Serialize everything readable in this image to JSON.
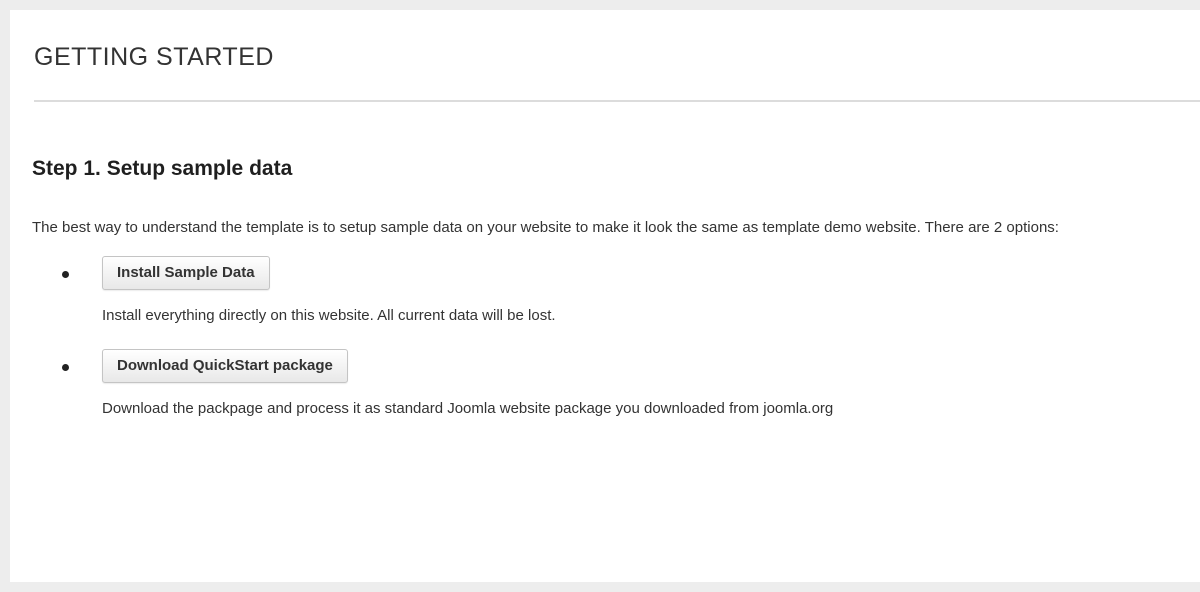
{
  "panel": {
    "title": "GETTING STARTED"
  },
  "step": {
    "title": "Step 1. Setup sample data",
    "intro": "The best way to understand the template is to setup sample data on your website to make it look the same as template demo website. There are 2 options:"
  },
  "options": [
    {
      "button_label": "Install Sample Data",
      "description": "Install everything directly on this website. All current data will be lost."
    },
    {
      "button_label": "Download QuickStart package",
      "description": "Download the packpage and process it as standard Joomla website package you downloaded from joomla.org"
    }
  ],
  "colors": {
    "page_background": "#ededed",
    "panel_background": "#ffffff",
    "divider": "#dcdcdc",
    "text": "#333333"
  }
}
